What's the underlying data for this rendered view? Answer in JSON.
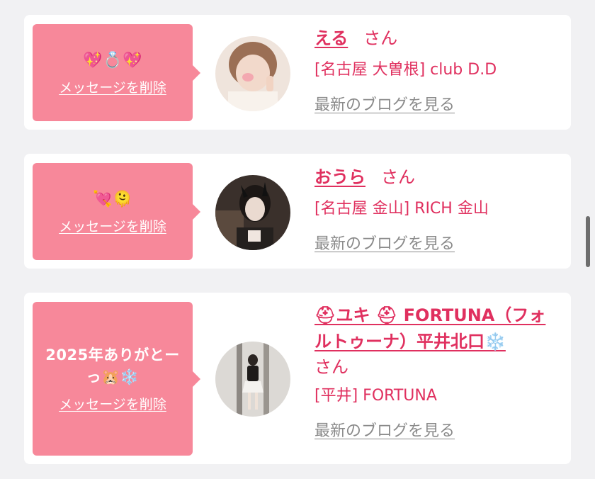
{
  "cards": [
    {
      "message": "💖💍💖",
      "delete_label": "メッセージを削除",
      "name": "える",
      "honorific": "さん",
      "shop": "[名古屋 大曽根] club D.D",
      "blog_label": "最新のブログを見る",
      "avatar_colors": [
        "#c9a58e",
        "#f0e4dc"
      ]
    },
    {
      "message": "💘🫠",
      "delete_label": "メッセージを削除",
      "name": "おうら",
      "honorific": "さん",
      "shop": "[名古屋 金山] RICH 金山",
      "blog_label": "最新のブログを見る",
      "avatar_colors": [
        "#2d2623",
        "#8a7766"
      ]
    },
    {
      "message": "2025年ありがとー っ🐹❄️",
      "delete_label": "メッセージを削除",
      "name": "⛑ユキ ⛑ FORTUNA（フォルトゥーナ）平井北口❄️",
      "honorific": "さん",
      "shop": "[平井] FORTUNA",
      "blog_label": "最新のブログを見る",
      "avatar_colors": [
        "#d9d6d2",
        "#7a7571"
      ]
    }
  ]
}
